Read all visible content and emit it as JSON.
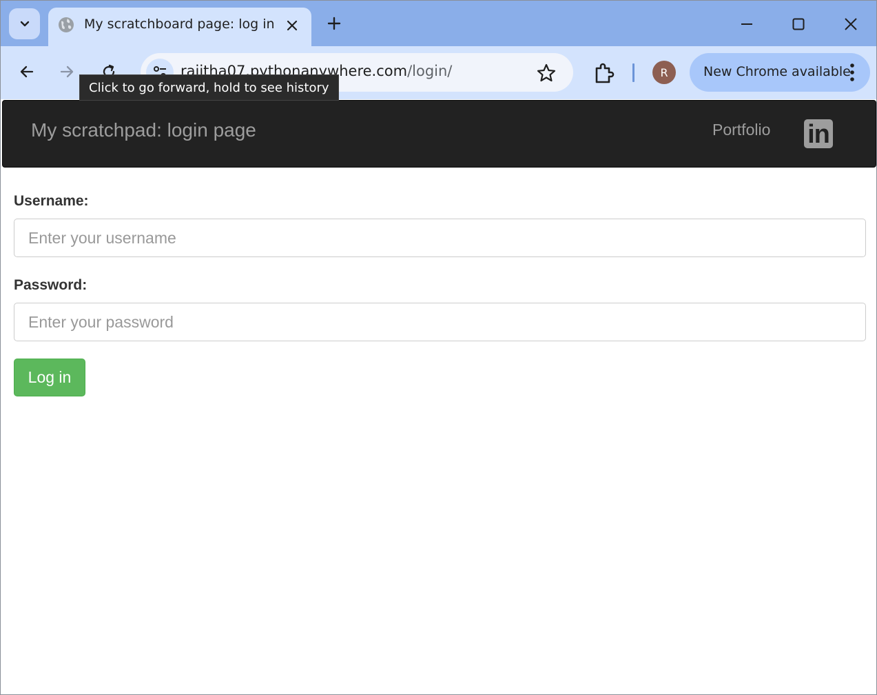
{
  "browser": {
    "tab": {
      "title": "My scratchboard page: log in",
      "favicon": "globe-icon"
    },
    "address": {
      "host": "rajitha07.pythonanywhere.com",
      "path": "/login/"
    },
    "profile_initial": "R",
    "update_label": "New Chrome available",
    "tooltip": "Click to go forward, hold to see history"
  },
  "navbar": {
    "brand": "My scratchpad: login page",
    "links": [
      {
        "label": "Portfolio"
      }
    ],
    "linkedin_text": "in"
  },
  "form": {
    "username_label": "Username:",
    "username_placeholder": "Enter your username",
    "password_label": "Password:",
    "password_placeholder": "Enter your password",
    "submit_label": "Log in"
  },
  "colors": {
    "navbar_bg": "#222222",
    "navbar_text": "#9d9d9d",
    "button_success": "#5cb85c",
    "tabstrip": "#8aaee9",
    "toolbar": "#d3e3fd"
  }
}
